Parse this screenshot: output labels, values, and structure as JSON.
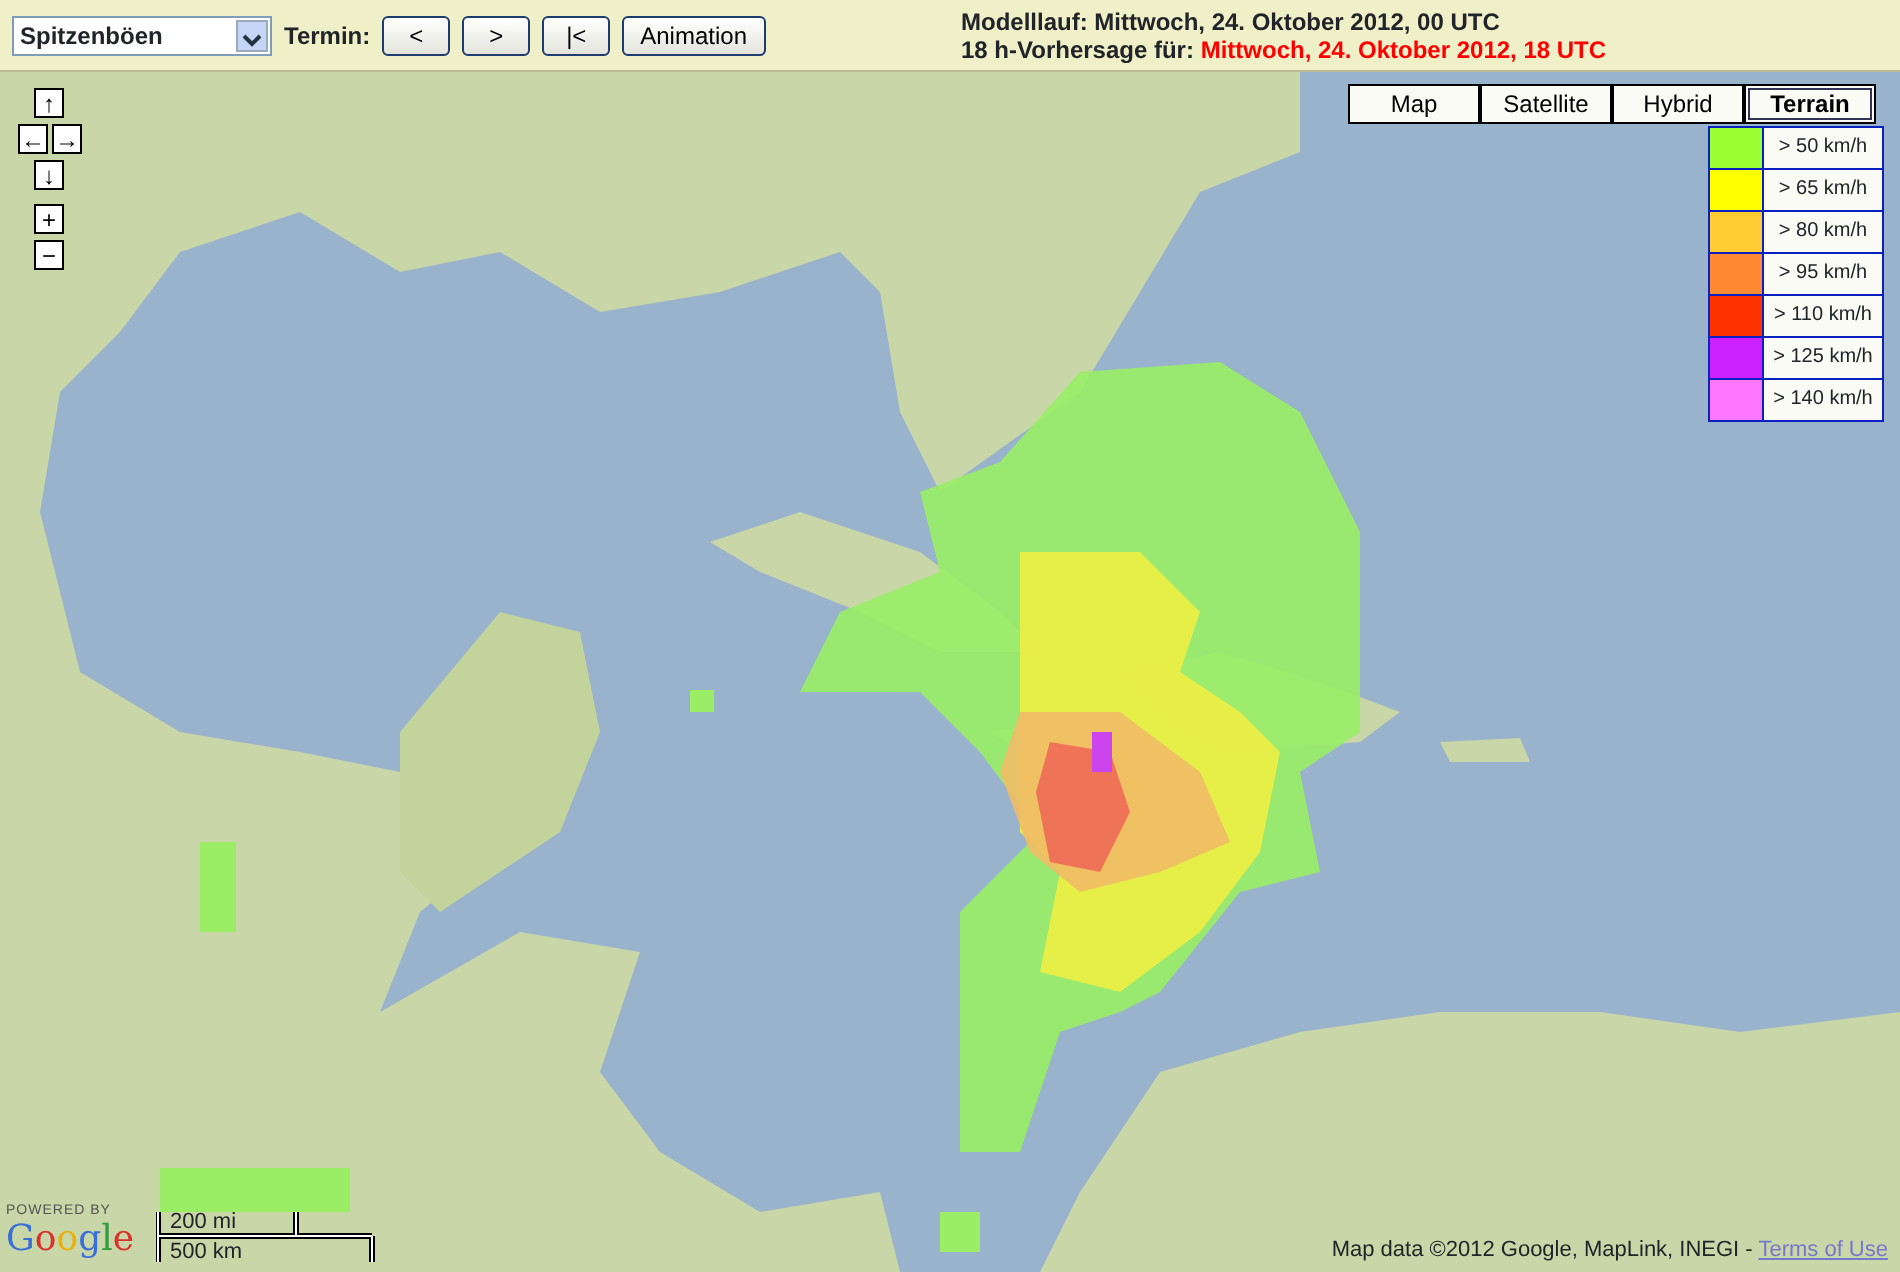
{
  "toolbar": {
    "parameter_select": {
      "value": "Spitzenböen"
    },
    "termin_label": "Termin:",
    "buttons": [
      "<",
      ">",
      "|<",
      "Animation"
    ],
    "model_run": {
      "label": "Modelllauf:",
      "value": "Mittwoch, 24. Oktober 2012, 00 UTC"
    },
    "forecast": {
      "label": "18 h-Vorhersage für:",
      "value": "Mittwoch, 24. Oktober 2012, 18 UTC"
    }
  },
  "map": {
    "pan_controls": [
      "↑",
      "←",
      "→",
      "↓"
    ],
    "zoom_controls": [
      "+",
      "−"
    ],
    "map_types": [
      {
        "label": "Map",
        "selected": false
      },
      {
        "label": "Satellite",
        "selected": false
      },
      {
        "label": "Hybrid",
        "selected": false
      },
      {
        "label": "Terrain",
        "selected": true
      }
    ],
    "legend": [
      {
        "label": "> 50 km/h",
        "color": "#99ff33"
      },
      {
        "label": "> 65 km/h",
        "color": "#ffff00"
      },
      {
        "label": "> 80 km/h",
        "color": "#ffcc33"
      },
      {
        "label": "> 95 km/h",
        "color": "#ff8833"
      },
      {
        "label": "> 110 km/h",
        "color": "#ff3300"
      },
      {
        "label": "> 125 km/h",
        "color": "#cc22ff"
      },
      {
        "label": "> 140 km/h",
        "color": "#ff77ff"
      }
    ],
    "branding": {
      "tagline": "POWERED BY",
      "logo": "Google"
    },
    "scale": [
      "200 mi",
      "500 km"
    ],
    "attribution": {
      "text": "Map data ©2012 Google, MapLink, INEGI -",
      "link": "Terms of Use"
    }
  }
}
